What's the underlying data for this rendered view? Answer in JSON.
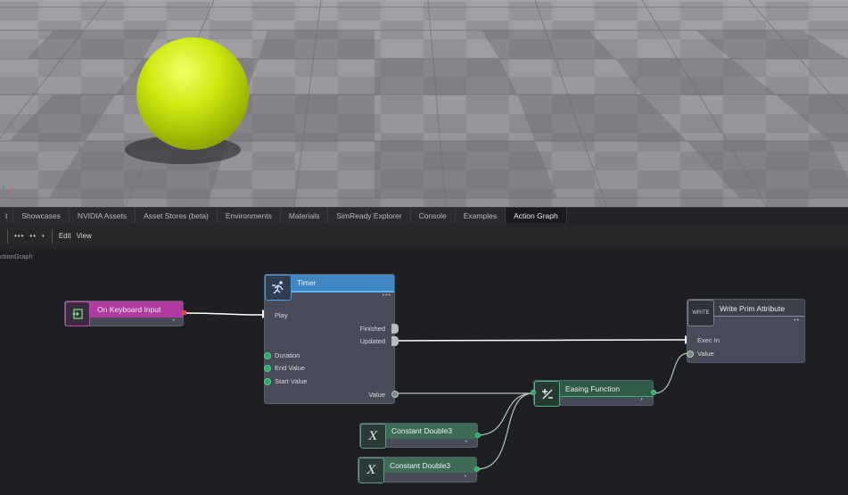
{
  "tabs": [
    {
      "label": "t",
      "active": false
    },
    {
      "label": "Showcases",
      "active": false
    },
    {
      "label": "NVIDIA Assets",
      "active": false
    },
    {
      "label": "Asset Stores (beta)",
      "active": false
    },
    {
      "label": "Environments",
      "active": false
    },
    {
      "label": "Materials",
      "active": false
    },
    {
      "label": "SimReady Explorer",
      "active": false
    },
    {
      "label": "Console",
      "active": false
    },
    {
      "label": "Examples",
      "active": false
    },
    {
      "label": "Action Graph",
      "active": true
    }
  ],
  "toolbar": {
    "btn_more": "•••",
    "btn_expand": "••",
    "btn_dot": "•",
    "menu_edit": "Edit",
    "menu_view": "View"
  },
  "graph_path": "ctionGraph",
  "colors": {
    "sphere": "#c8e80f",
    "keyboard_header": "#b03aa0",
    "timer_header": "#3f86c2",
    "easing_header": "#2f5a46",
    "constant_header": "#3d6b55",
    "write_header": "#3a3f4a",
    "wire": "#ffffff",
    "pin_green": "#2ea86b"
  },
  "nodes": {
    "keyboard": {
      "title": "On Keyboard Input",
      "icon": "keyboard-input-icon"
    },
    "timer": {
      "title": "Timer",
      "icon": "running-person-icon",
      "dots": "•••",
      "inputs": {
        "play": "Play",
        "duration": "Duration",
        "end_value": "End Value",
        "start_value": "Start Value"
      },
      "outputs": {
        "finished": "Finished",
        "updated": "Updated",
        "value": "Value"
      }
    },
    "write": {
      "title": "Write Prim Attribute",
      "icon_label": "WRITE",
      "dots": "••",
      "inputs": {
        "exec_in": "Exec In",
        "value": "Value"
      }
    },
    "easing": {
      "title": "Easing Function",
      "icon": "plus-minus-icon",
      "dots": "•"
    },
    "const1": {
      "title": "Constant Double3",
      "icon_label": "X",
      "dots": "•"
    },
    "const2": {
      "title": "Constant Double3",
      "icon_label": "X",
      "dots": "•"
    }
  }
}
